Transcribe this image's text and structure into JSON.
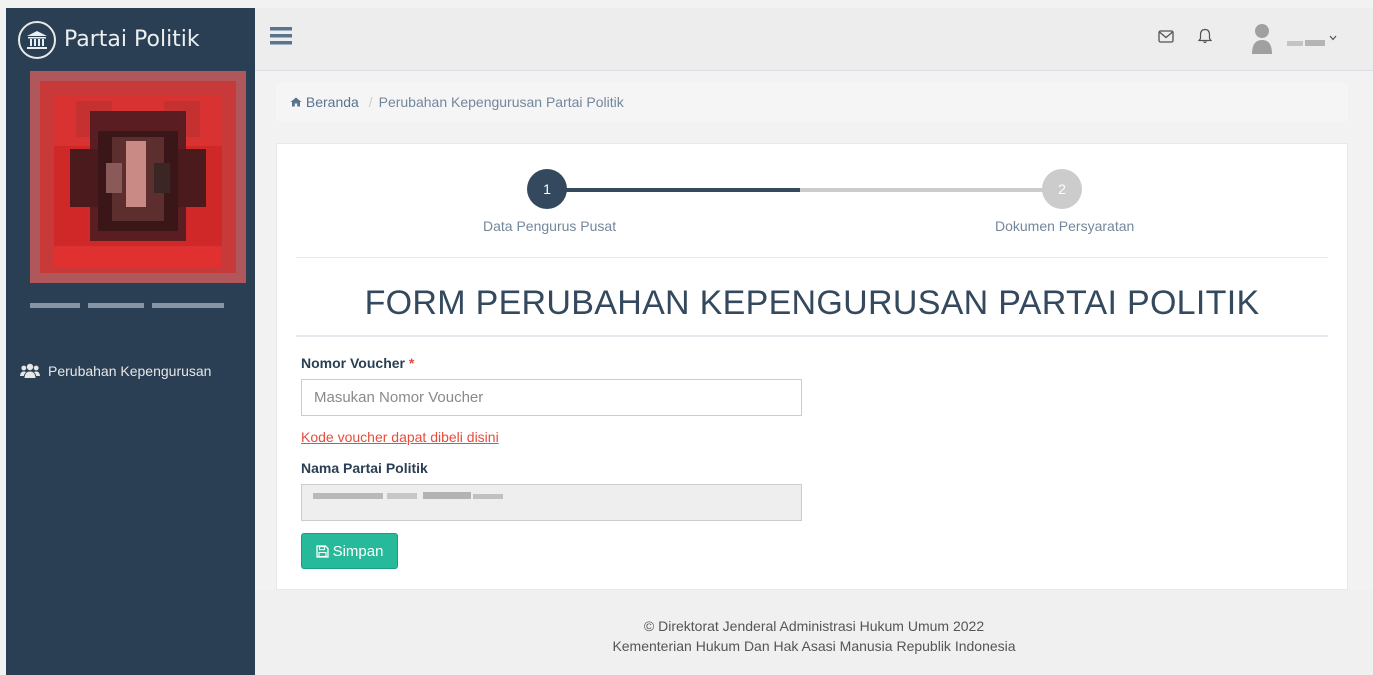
{
  "brand": {
    "title": "Partai Politik",
    "icon": "bank-icon"
  },
  "sidebar": {
    "menu": [
      {
        "label": "Perubahan Kepengurusan",
        "icon": "users-icon"
      }
    ]
  },
  "topbar": {
    "menu_icon": "hamburger-icon",
    "mail_icon": "envelope-icon",
    "bell_icon": "bell-icon",
    "user_icon": "user-avatar-icon",
    "dropdown_icon": "chevron-down-icon"
  },
  "breadcrumb": {
    "home": "Beranda",
    "separator": "/",
    "current": "Perubahan Kepengurusan Partai Politik"
  },
  "wizard": {
    "steps": [
      {
        "number": "1",
        "label": "Data Pengurus Pusat",
        "state": "active"
      },
      {
        "number": "2",
        "label": "Dokumen Persyaratan",
        "state": "inactive"
      }
    ]
  },
  "form": {
    "title": "FORM PERUBAHAN KEPENGURUSAN PARTAI POLITIK",
    "voucher_label": "Nomor Voucher",
    "required_mark": "*",
    "voucher_placeholder": "Masukan Nomor Voucher",
    "voucher_value": "",
    "voucher_link": "Kode voucher dapat dibeli disini",
    "party_label": "Nama Partai Politik",
    "save_label": "Simpan"
  },
  "footer": {
    "line1": "© Direktorat Jenderal Administrasi Hukum Umum 2022",
    "line2": "Kementerian Hukum Dan Hak Asasi Manusia Republik Indonesia"
  },
  "colors": {
    "sidebar": "#2a3f54",
    "step_active": "#34495e",
    "step_inactive": "#cccccc",
    "save_button": "#26b99a",
    "link": "#e74c3c"
  }
}
